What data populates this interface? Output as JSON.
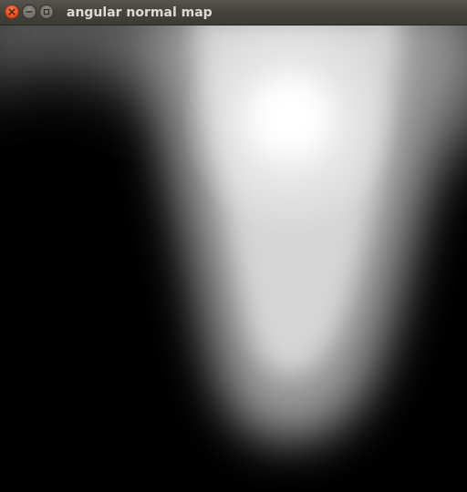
{
  "window": {
    "title": "angular normal map",
    "controls": [
      {
        "name": "close",
        "icon": "close-icon",
        "color": "#e4572b"
      },
      {
        "name": "minimize",
        "icon": "minimize-icon",
        "color": "#76746e"
      },
      {
        "name": "maximize",
        "icon": "maximize-icon",
        "color": "#76746e"
      }
    ]
  },
  "render": {
    "background": "#000000",
    "foreground": "#ffffff"
  }
}
